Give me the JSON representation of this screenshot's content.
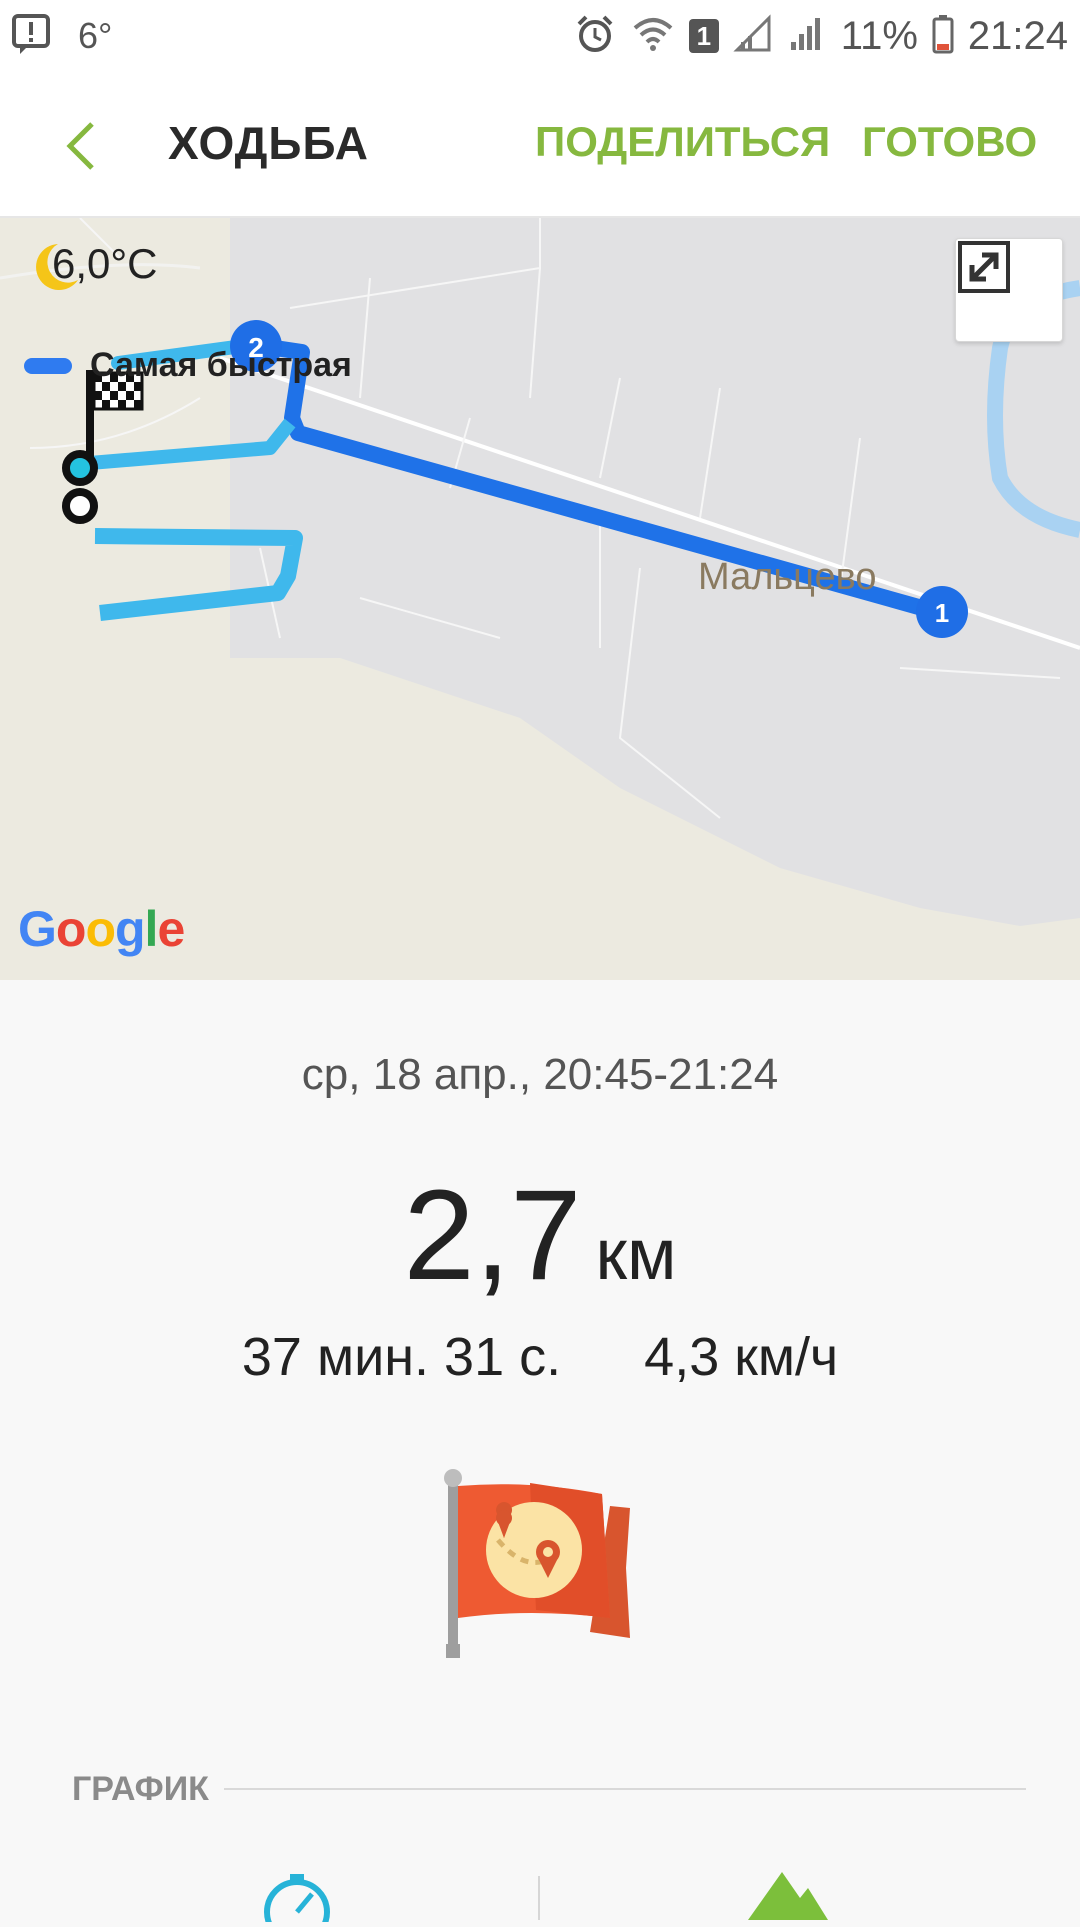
{
  "status_bar": {
    "temperature": "6°",
    "sim_badge": "1",
    "battery_percent": "11%",
    "time": "21:24"
  },
  "header": {
    "title": "ХОДЬБА",
    "share_label": "ПОДЕЛИТЬСЯ",
    "done_label": "ГОТОВО",
    "accent_color": "#86b83f"
  },
  "map": {
    "weather_icon": "moon-icon",
    "temperature": "6,0°C",
    "legend_label": "Самая быстрая",
    "legend_color": "#2f7bf0",
    "place_label": "Мальцево",
    "marker_1": "1",
    "marker_2": "2",
    "google_letters": [
      "G",
      "o",
      "o",
      "g",
      "l",
      "e"
    ]
  },
  "workout": {
    "date_range": "ср, 18 апр., 20:45-21:24",
    "distance_value": "2,7",
    "distance_unit": "км",
    "duration": "37 мин. 31 с.",
    "speed": "4,3 км/ч",
    "badge_icon": "route-flag-icon"
  },
  "graph": {
    "header": "ГРАФИК"
  }
}
